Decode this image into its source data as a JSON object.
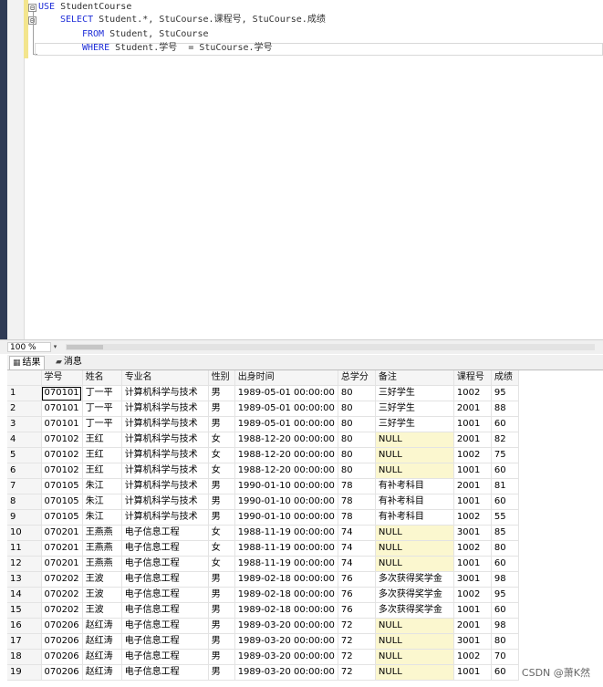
{
  "editor": {
    "lines": [
      [
        {
          "t": "USE",
          "k": true
        },
        {
          "t": " StudentCourse",
          "k": false
        }
      ],
      [
        {
          "t": "SELECT",
          "k": true
        },
        {
          "t": " Student.*, StuCourse.课程号, StuCourse.成绩",
          "k": false
        }
      ],
      [
        {
          "t": "FROM",
          "k": true
        },
        {
          "t": " Student, StuCourse",
          "k": false
        }
      ],
      [
        {
          "t": "WHERE",
          "k": true
        },
        {
          "t": " Student.学号  = StuCourse.学号",
          "k": false
        }
      ]
    ],
    "fold_glyph": "⊟"
  },
  "zoom": {
    "value": "100 %",
    "arrow": "▾"
  },
  "tabs": {
    "results": {
      "label": "结果",
      "icon": "▦"
    },
    "messages": {
      "label": "消息",
      "icon": "▰"
    }
  },
  "grid": {
    "columns": [
      "",
      "学号",
      "姓名",
      "专业名",
      "性别",
      "出身时间",
      "总学分",
      "备注",
      "课程号",
      "成绩"
    ],
    "rows": [
      [
        "1",
        "070101",
        "丁一平",
        "计算机科学与技术",
        "男",
        "1989-05-01 00:00:00",
        "80",
        "三好学生",
        "1002",
        "95"
      ],
      [
        "2",
        "070101",
        "丁一平",
        "计算机科学与技术",
        "男",
        "1989-05-01 00:00:00",
        "80",
        "三好学生",
        "2001",
        "88"
      ],
      [
        "3",
        "070101",
        "丁一平",
        "计算机科学与技术",
        "男",
        "1989-05-01 00:00:00",
        "80",
        "三好学生",
        "1001",
        "60"
      ],
      [
        "4",
        "070102",
        "王红",
        "计算机科学与技术",
        "女",
        "1988-12-20 00:00:00",
        "80",
        "NULL",
        "2001",
        "82"
      ],
      [
        "5",
        "070102",
        "王红",
        "计算机科学与技术",
        "女",
        "1988-12-20 00:00:00",
        "80",
        "NULL",
        "1002",
        "75"
      ],
      [
        "6",
        "070102",
        "王红",
        "计算机科学与技术",
        "女",
        "1988-12-20 00:00:00",
        "80",
        "NULL",
        "1001",
        "60"
      ],
      [
        "7",
        "070105",
        "朱江",
        "计算机科学与技术",
        "男",
        "1990-01-10 00:00:00",
        "78",
        "有补考科目",
        "2001",
        "81"
      ],
      [
        "8",
        "070105",
        "朱江",
        "计算机科学与技术",
        "男",
        "1990-01-10 00:00:00",
        "78",
        "有补考科目",
        "1001",
        "60"
      ],
      [
        "9",
        "070105",
        "朱江",
        "计算机科学与技术",
        "男",
        "1990-01-10 00:00:00",
        "78",
        "有补考科目",
        "1002",
        "55"
      ],
      [
        "10",
        "070201",
        "王燕燕",
        "电子信息工程",
        "女",
        "1988-11-19 00:00:00",
        "74",
        "NULL",
        "3001",
        "85"
      ],
      [
        "11",
        "070201",
        "王燕燕",
        "电子信息工程",
        "女",
        "1988-11-19 00:00:00",
        "74",
        "NULL",
        "1002",
        "80"
      ],
      [
        "12",
        "070201",
        "王燕燕",
        "电子信息工程",
        "女",
        "1988-11-19 00:00:00",
        "74",
        "NULL",
        "1001",
        "60"
      ],
      [
        "13",
        "070202",
        "王波",
        "电子信息工程",
        "男",
        "1989-02-18 00:00:00",
        "76",
        "多次获得奖学金",
        "3001",
        "98"
      ],
      [
        "14",
        "070202",
        "王波",
        "电子信息工程",
        "男",
        "1989-02-18 00:00:00",
        "76",
        "多次获得奖学金",
        "1002",
        "95"
      ],
      [
        "15",
        "070202",
        "王波",
        "电子信息工程",
        "男",
        "1989-02-18 00:00:00",
        "76",
        "多次获得奖学金",
        "1001",
        "60"
      ],
      [
        "16",
        "070206",
        "赵红涛",
        "电子信息工程",
        "男",
        "1989-03-20 00:00:00",
        "72",
        "NULL",
        "2001",
        "98"
      ],
      [
        "17",
        "070206",
        "赵红涛",
        "电子信息工程",
        "男",
        "1989-03-20 00:00:00",
        "72",
        "NULL",
        "3001",
        "80"
      ],
      [
        "18",
        "070206",
        "赵红涛",
        "电子信息工程",
        "男",
        "1989-03-20 00:00:00",
        "72",
        "NULL",
        "1002",
        "70"
      ],
      [
        "19",
        "070206",
        "赵红涛",
        "电子信息工程",
        "男",
        "1989-03-20 00:00:00",
        "72",
        "NULL",
        "1001",
        "60"
      ]
    ]
  },
  "watermark": "CSDN @萧K然",
  "colors": {
    "keyword": "#1f2ed8",
    "null_cell": "#fbf7cf",
    "header_bg": "#f5f5f5",
    "sidebar": "#2f3b55"
  }
}
